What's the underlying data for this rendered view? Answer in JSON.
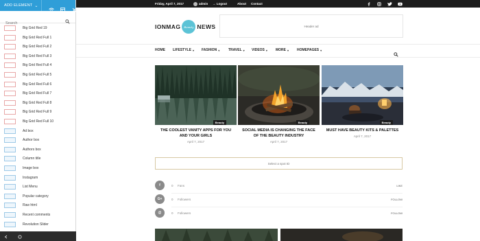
{
  "panel": {
    "add_element_label": "ADD ELEMENT",
    "search_placeholder": "Search",
    "items": [
      {
        "label": "Big Grid Red 19",
        "thumb": "grid"
      },
      {
        "label": "Big Grid Red Full 1",
        "thumb": "grid"
      },
      {
        "label": "Big Grid Red Full 2",
        "thumb": "grid"
      },
      {
        "label": "Big Grid Red Full 3",
        "thumb": "grid"
      },
      {
        "label": "Big Grid Red Full 4",
        "thumb": "grid"
      },
      {
        "label": "Big Grid Red Full 5",
        "thumb": "grid"
      },
      {
        "label": "Big Grid Red Full 6",
        "thumb": "grid"
      },
      {
        "label": "Big Grid Red Full 7",
        "thumb": "grid"
      },
      {
        "label": "Big Grid Red Full 8",
        "thumb": "grid"
      },
      {
        "label": "Big Grid Red Full 9",
        "thumb": "grid"
      },
      {
        "label": "Big Grid Red Full 10",
        "thumb": "grid"
      },
      {
        "label": "Ad box",
        "thumb": "blue"
      },
      {
        "label": "Author box",
        "thumb": "blue"
      },
      {
        "label": "Authors box",
        "thumb": "blue"
      },
      {
        "label": "Column title",
        "thumb": "blue"
      },
      {
        "label": "Image box",
        "thumb": "blue"
      },
      {
        "label": "Instagram",
        "thumb": "blue"
      },
      {
        "label": "List Menu",
        "thumb": "blue"
      },
      {
        "label": "Popular category",
        "thumb": "blue"
      },
      {
        "label": "Raw html",
        "thumb": "blue"
      },
      {
        "label": "Recent comments",
        "thumb": "blue"
      },
      {
        "label": "Revolution Slider",
        "thumb": "blue"
      }
    ]
  },
  "topbar": {
    "date": "Friday, April 7, 2017",
    "user": "admin",
    "logout": "Logout",
    "about": "About",
    "contact": "Contact"
  },
  "header": {
    "logo_left": "IONMAG",
    "logo_badge": "Beauty",
    "logo_right": "NEWS",
    "ad_label": "Header ad"
  },
  "nav": {
    "items": [
      {
        "label": "HOME",
        "dropdown": false
      },
      {
        "label": "LIFESTYLE",
        "dropdown": true
      },
      {
        "label": "FASHION",
        "dropdown": true
      },
      {
        "label": "TRAVEL",
        "dropdown": true
      },
      {
        "label": "VIDEOS",
        "dropdown": true
      },
      {
        "label": "MORE",
        "dropdown": true
      },
      {
        "label": "HOMEPAGES",
        "dropdown": true
      }
    ]
  },
  "posts": [
    {
      "category": "Beauty",
      "title": "THE COOLEST VANITY APPS FOR YOU AND YOUR GIRLS",
      "date": "April 7, 2017"
    },
    {
      "category": "Beauty",
      "title": "SOCIAL MEDIA IS CHANGING THE FACE OF THE BEAUTY INDUSTRY",
      "date": "April 7, 2017"
    },
    {
      "category": "Beauty",
      "title": "MUST HAVE BEAUTY KITS & PALETTES",
      "date": "April 7, 2017"
    }
  ],
  "select_spot": "Select a spot ID",
  "counters": [
    {
      "icon": "f",
      "count": "0",
      "label": "Fans",
      "action": "LIKE"
    },
    {
      "icon": "G+",
      "count": "0",
      "label": "Followers",
      "action": "FOLLOW"
    },
    {
      "icon": "@",
      "count": "0",
      "label": "Followers",
      "action": "FOLLOW"
    }
  ],
  "colors": {
    "panel_accent": "#2f9ed8",
    "logo_circle": "#5cc3d6",
    "topbar": "#1c1c1c"
  }
}
